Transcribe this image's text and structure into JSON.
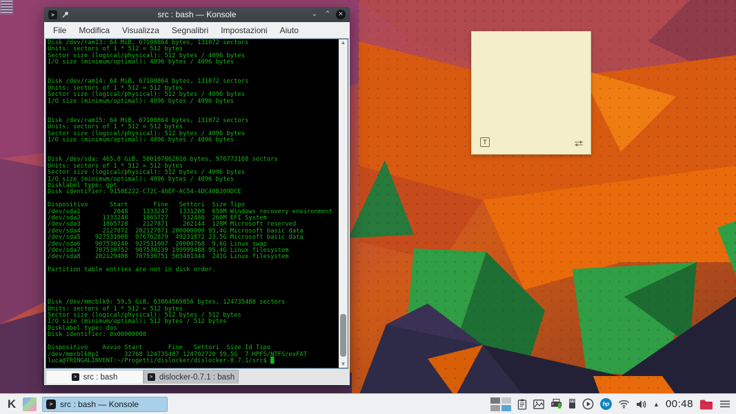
{
  "colors": {
    "terminal_green": "#17b517",
    "terminal_bg": "#000000",
    "titlebar": "#3f454b",
    "panel_bg": "#eef0f1",
    "task_active_blue": "#a8d0e8",
    "note_cream": "#f4eecb",
    "hp_blue": "#0f82c0",
    "folder_red": "#d62e4e",
    "pager_active_blue": "#5ba5d4"
  },
  "window": {
    "title": "src : bash — Konsole",
    "app_icon_glyph": ">",
    "minimize_glyph": "⌄",
    "maximize_glyph": "⌃",
    "close_glyph": "✕",
    "menu": [
      "File",
      "Modifica",
      "Visualizza",
      "Segnalibri",
      "Impostazioni",
      "Aiuto"
    ],
    "scroll_up_glyph": "▲",
    "scroll_down_glyph": "▼",
    "terminal_lines": [
      "Disk /dev/ram13: 64 MiB, 67108864 bytes, 131072 sectors",
      "Units: sectors of 1 * 512 = 512 bytes",
      "Sector size (logical/physical): 512 bytes / 4096 bytes",
      "I/O size (minimum/optimal): 4096 bytes / 4096 bytes",
      "",
      "",
      "Disk /dev/ram14: 64 MiB, 67108864 bytes, 131072 sectors",
      "Units: sectors of 1 * 512 = 512 bytes",
      "Sector size (logical/physical): 512 bytes / 4096 bytes",
      "I/O size (minimum/optimal): 4096 bytes / 4096 bytes",
      "",
      "",
      "Disk /dev/ram15: 64 MiB, 67108864 bytes, 131072 sectors",
      "Units: sectors of 1 * 512 = 512 bytes",
      "Sector size (logical/physical): 512 bytes / 4096 bytes",
      "I/O size (minimum/optimal): 4096 bytes / 4096 bytes",
      "",
      "",
      "Disk /dev/sda: 465,8 GiB, 500107862016 bytes, 976773168 sectors",
      "Units: sectors of 1 * 512 = 512 bytes",
      "Sector size (logical/physical): 512 bytes / 4096 bytes",
      "I/O size (minimum/optimal): 4096 bytes / 4096 bytes",
      "Disklabel type: gpt",
      "Disk identifier: 9158E222-C72C-46EF-AC54-4DC40B209DCE",
      "",
      "Dispositivo      Start       Fine   Settori  Size Tipo",
      "/dev/sda1         2048    1333247   1331200  650M Windows recovery environment",
      "/dev/sda2      1333248    1865727    532480  260M EFI System",
      "/dev/sda3      1865728    2127871    262144  128M Microsoft reserved",
      "/dev/sda4      2127872  202127871 200000000 95,4G Microsoft basic data",
      "/dev/sda5    927531008  976762879  49231872 23,5G Microsoft basic data",
      "/dev/sda6    907530240  927531007  20000768  9,6G Linux swap",
      "/dev/sda7    707530752  907530239 199999488 95,4G Linux filesystem",
      "/dev/sda8    202129408  707530751 505401344  241G Linux filesystem",
      "",
      "Partition table entries are not in disk order.",
      "",
      "",
      "",
      "",
      "Disk /dev/mmcblk0: 59,5 GiB, 63864569856 bytes, 124735488 sectors",
      "Units: sectors of 1 * 512 = 512 bytes",
      "Sector size (logical/physical): 512 bytes / 512 bytes",
      "I/O size (minimum/optimal): 512 bytes / 512 bytes",
      "Disklabel type: dos",
      "Disk identifier: 0x00000000",
      "",
      "Dispositivo    Avvio Start       Fine   Settori  Size Id Tipo",
      "/dev/mmcblk0p1       32768 124735487 124702720 59,5G  7 HPFS/NTFS/exFAT",
      "luca@TRINGALINVENT:~/Progetti/dislocker/dislocker-0.7.1/src$ █"
    ],
    "tabs": [
      {
        "label": "src : bash",
        "active": true
      },
      {
        "label": "dislocker-0.7.1 : bash",
        "active": false
      }
    ]
  },
  "note": {
    "format_icon_glyph": "T"
  },
  "taskbar": {
    "launcher_glyph": "K",
    "task_label": "src : bash — Konsole",
    "hp_label": "hp",
    "caret_glyph": "▲",
    "clock": "00:48"
  }
}
